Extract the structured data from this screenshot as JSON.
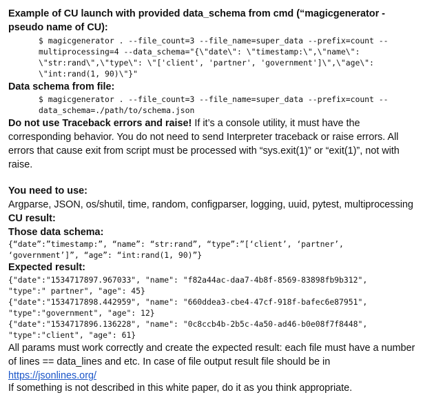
{
  "example_heading_1": "Example of CU launch with provided data_schema from cmd (“magicgenerator -",
  "example_heading_2": "pseudo name of CU):",
  "cmd_example_lines": [
    "$ magicgenerator . --file_count=3 --file_name=super_data --prefix=count --",
    "multiprocessing=4 --data_schema=\"{\\\"date\\\": \\\"timestamp:\\\",\\\"name\\\":",
    "\\\"str:rand\\\",\\\"type\\\": \\\"['client', 'partner', 'government']\\\",\\\"age\\\":",
    "\\\"int:rand(1, 90)\\\"}\""
  ],
  "schema_file_heading": "Data schema from file:",
  "cmd_file_lines": [
    "$ magicgenerator . --file_count=3 --file_name=super_data --prefix=count --",
    "data_schema=./path/to/schema.json"
  ],
  "traceback_bold": "Do not use Traceback errors and raise!",
  "traceback_lines": [
    " If it’s a console utility, it must have the",
    "corresponding behavior. You do not need to send Interpreter traceback or raise errors. All",
    "errors that cause exit from script must be processed with “sys.exit(1)” or “exit(1)”, not with",
    "raise."
  ],
  "need_heading": "You need to use:",
  "libraries": "Argparse, JSON, os/shutil, time, random, configparser, logging, uuid, pytest, multiprocessing",
  "cu_result_heading": "CU result:",
  "schema_heading": "Those data schema:",
  "schema_lines": [
    "{“date”:”timestamp:”, “name”: “str:rand”, “type”:”[‘client’, ‘partner’,",
    "‘government’]”, “age”: “int:rand(1, 90)”}"
  ],
  "expected_heading": "Expected result:",
  "expected_lines": [
    "{\"date\":\"1534717897.967033\", \"name\": \"f82a44ac-daa7-4b8f-8569-83898fb9b312\",",
    "\"type\":\" partner\", \"age\": 45}",
    "{\"date\":\"1534717898.442959\", \"name\": \"660ddea3-cbe4-47cf-918f-bafec6e87951\",",
    "\"type\":\"government\", \"age\": 12}",
    "{\"date\":\"1534717896.136228\", \"name\": \"0c8ccb4b-2b5c-4a50-ad46-b0e08f7f8448\",",
    "\"type\":\"client\", \"age\": 61}"
  ],
  "params_lines": [
    "All params must work correctly and create the expected result: each file must have a number",
    "of lines == data_lines and etc. In case of file output result file should be in"
  ],
  "jsonlines_link": "https://jsonlines.org/",
  "final_note": "If something is not described in this white paper, do it as you think appropriate.",
  "colors": {
    "text": "#111111",
    "link": "#1a55c8",
    "background": "#ffffff"
  }
}
